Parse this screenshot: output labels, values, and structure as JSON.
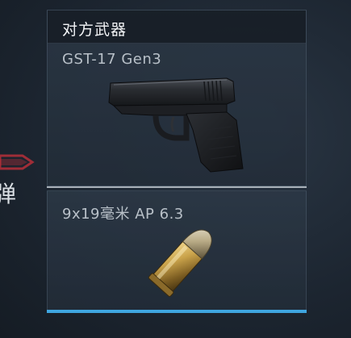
{
  "panel": {
    "title": "对方武器",
    "weapon": {
      "name": "GST-17 Gen3",
      "icon": "pistol-icon"
    },
    "ammo": {
      "name": "9x19毫米 AP 6.3",
      "icon": "bullet-icon"
    }
  },
  "left_edge": {
    "glyph": "弹",
    "arrow_icon": "red-arrow-icon"
  },
  "colors": {
    "accent": "#3fa6e0",
    "arrow": "#c0303a"
  }
}
